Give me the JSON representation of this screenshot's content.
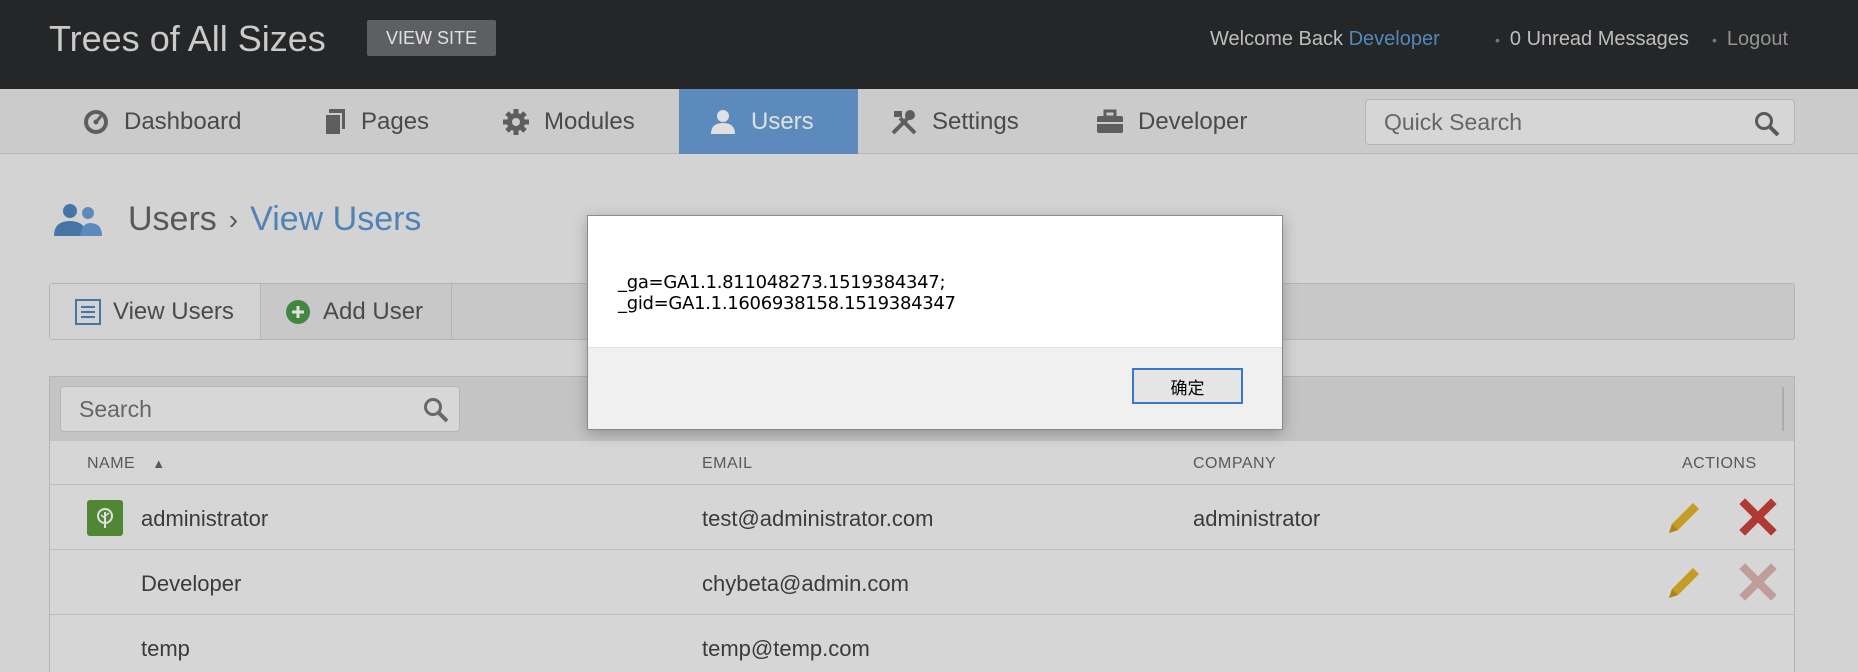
{
  "header": {
    "site_title": "Trees of All Sizes",
    "view_site": "VIEW SITE",
    "welcome_prefix": "Welcome Back",
    "welcome_user": "Developer",
    "unread": "0 Unread Messages",
    "logout": "Logout"
  },
  "nav": {
    "items": [
      {
        "label": "Dashboard",
        "icon": "dashboard-icon"
      },
      {
        "label": "Pages",
        "icon": "pages-icon"
      },
      {
        "label": "Modules",
        "icon": "gear-icon"
      },
      {
        "label": "Users",
        "icon": "user-icon"
      },
      {
        "label": "Settings",
        "icon": "tools-icon"
      },
      {
        "label": "Developer",
        "icon": "briefcase-icon"
      }
    ],
    "active": "Users",
    "search_placeholder": "Quick Search"
  },
  "breadcrumb": {
    "section": "Users",
    "separator": "›",
    "current": "View Users"
  },
  "tabs": [
    {
      "label": "View Users",
      "icon": "list-icon"
    },
    {
      "label": "Add User",
      "icon": "add-circle-icon"
    }
  ],
  "table": {
    "search_placeholder": "Search",
    "columns": {
      "name": "NAME",
      "sort_indicator": "▲",
      "email": "EMAIL",
      "company": "COMPANY",
      "actions": "ACTIONS"
    },
    "rows": [
      {
        "name": "administrator",
        "email": "test@administrator.com",
        "company": "administrator"
      },
      {
        "name": "Developer",
        "email": "chybeta@admin.com",
        "company": ""
      },
      {
        "name": "temp",
        "email": "temp@temp.com",
        "company": ""
      }
    ]
  },
  "dialog": {
    "message": "_ga=GA1.1.811048273.1519384347; _gid=GA1.1.1606938158.1519384347",
    "ok_label": "确定"
  },
  "colors": {
    "accent": "#6a9ed6",
    "link": "#5a96d2",
    "header_bg": "#2a2c2e",
    "edit": "#e1b22a",
    "delete": "#c9413b"
  }
}
